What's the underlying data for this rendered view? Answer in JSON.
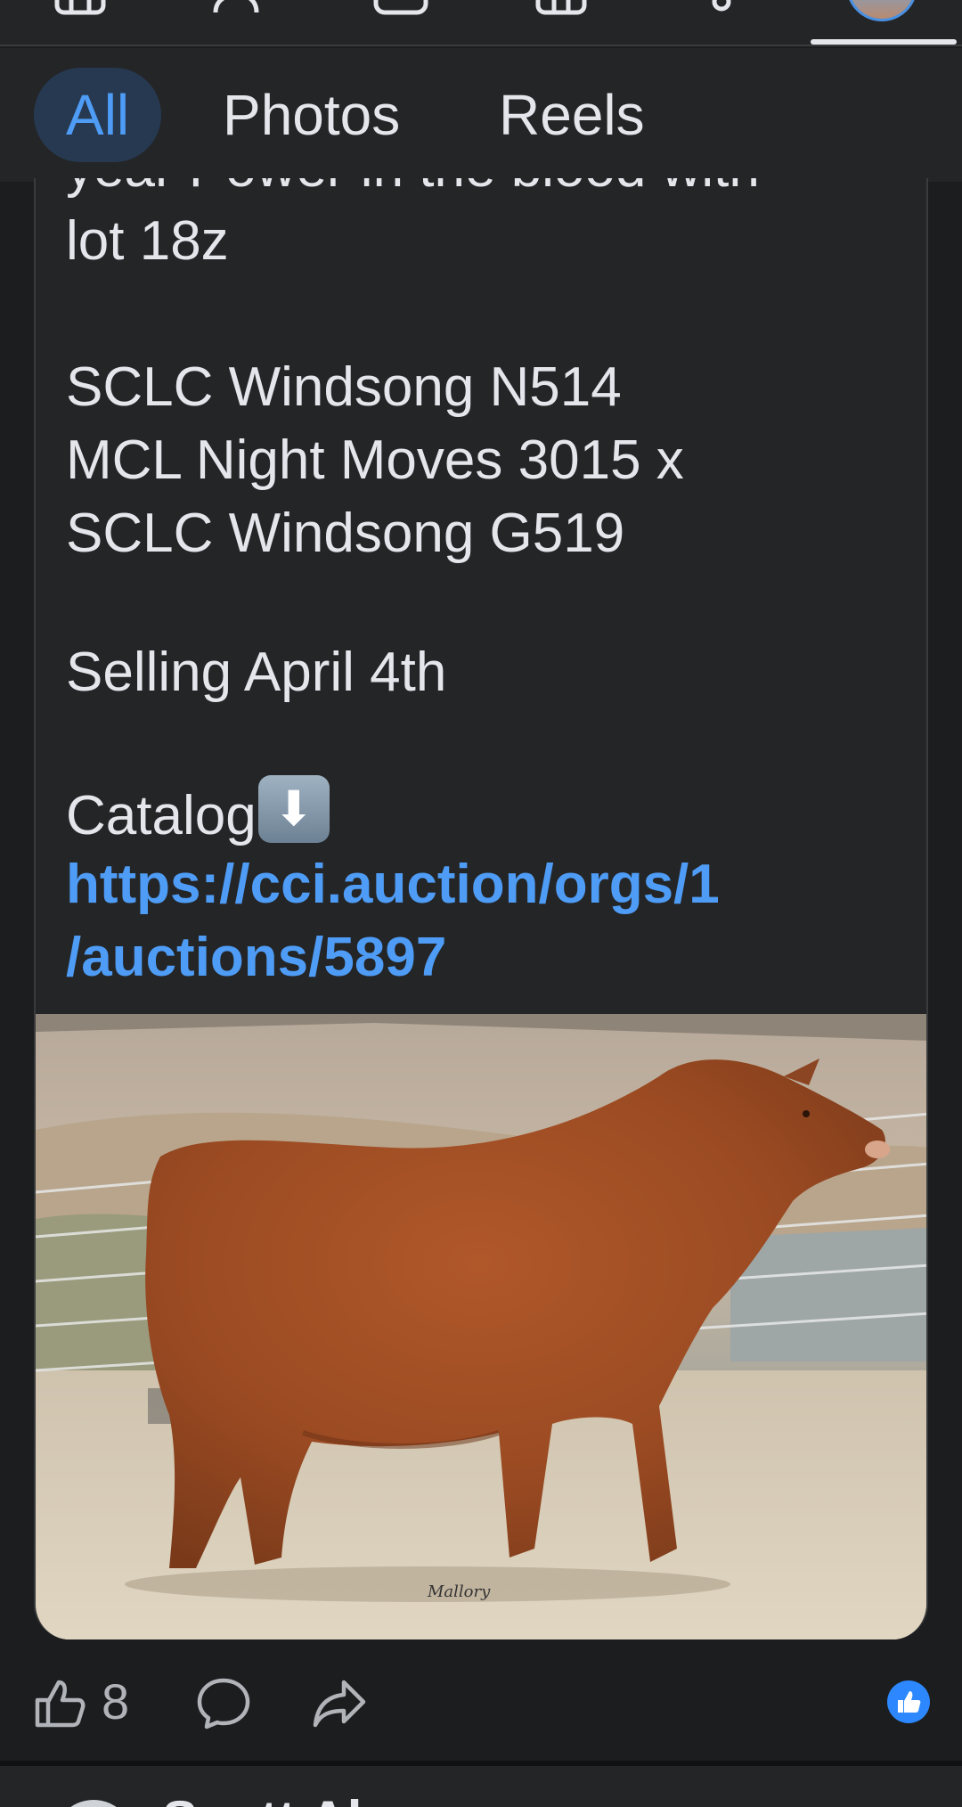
{
  "top_nav": {
    "icons": [
      "home-icon",
      "friends-icon",
      "video-icon",
      "marketplace-icon",
      "notifications-icon",
      "profile-avatar"
    ]
  },
  "filters": {
    "all": "All",
    "photos": "Photos",
    "reels": "Reels",
    "active": "All"
  },
  "post": {
    "cut_line": "year Power in the blood with",
    "lot_line": "lot 18z",
    "name_line": "SCLC Windsong N514",
    "sire_line": "MCL Night Moves 3015 x",
    "dam_line": "SCLC Windsong G519",
    "sale_line": "Selling April 4th",
    "catalog_label": "Catalog",
    "link_line1": "https://cci.auction/orgs/1",
    "link_line2": "/auctions/5897",
    "photo_signature": "Mallory"
  },
  "actions": {
    "like_count": "8",
    "like_icon": "like-icon",
    "comment_icon": "comment-icon",
    "share_icon": "share-icon"
  },
  "next_post": {
    "author_partial": "Scott Al"
  },
  "colors": {
    "background": "#1c1d1f",
    "surface": "#242527",
    "accent": "#4e9cf5",
    "reaction": "#2d88ff"
  }
}
